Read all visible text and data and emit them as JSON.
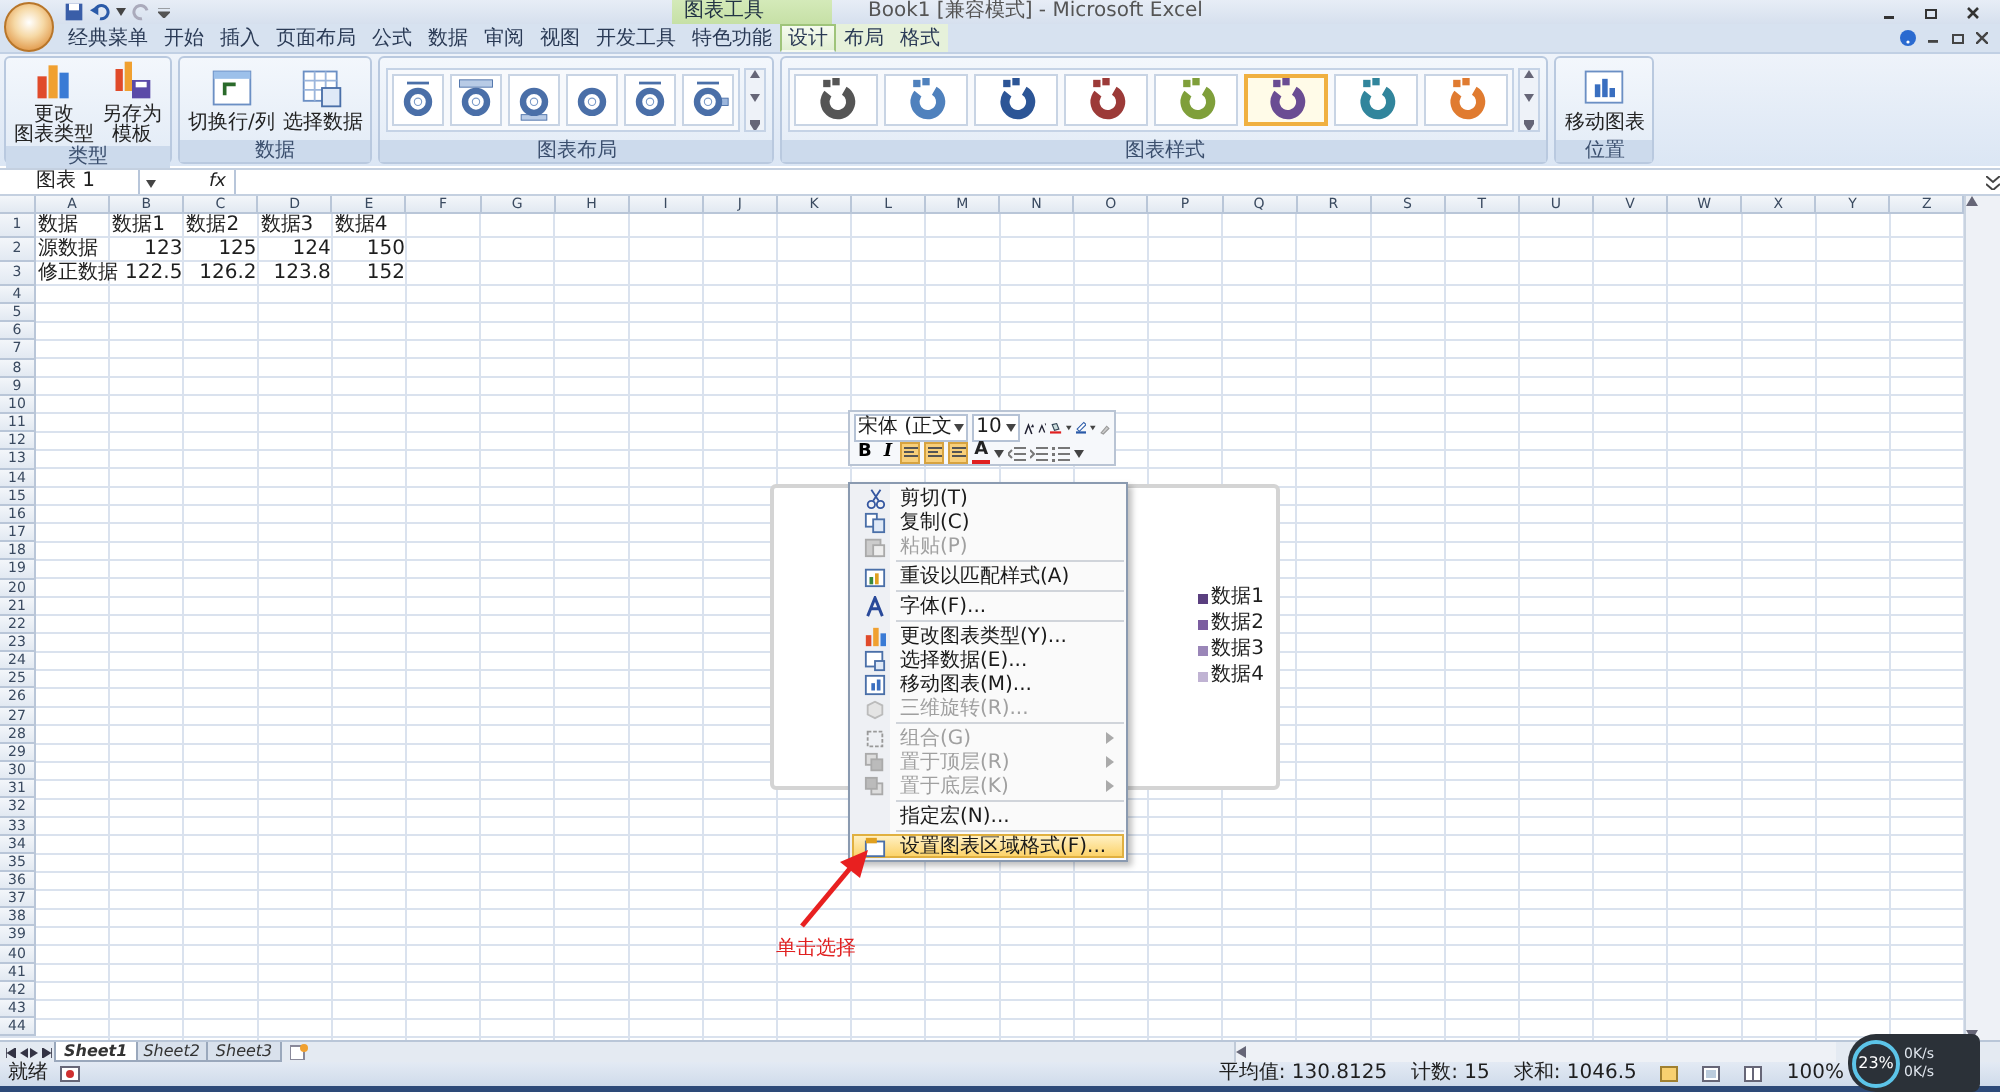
{
  "title_bar": {
    "context_tab": "图表工具",
    "title": "Book1 [兼容模式] - Microsoft Excel"
  },
  "tabs": [
    {
      "label": "经典菜单",
      "selected": false
    },
    {
      "label": "开始",
      "selected": false
    },
    {
      "label": "插入",
      "selected": false
    },
    {
      "label": "页面布局",
      "selected": false
    },
    {
      "label": "公式",
      "selected": false
    },
    {
      "label": "数据",
      "selected": false
    },
    {
      "label": "审阅",
      "selected": false
    },
    {
      "label": "视图",
      "selected": false
    },
    {
      "label": "开发工具",
      "selected": false
    },
    {
      "label": "特色功能",
      "selected": false
    },
    {
      "label": "设计",
      "selected": true,
      "contextual": true
    },
    {
      "label": "布局",
      "selected": false,
      "contextual": true
    },
    {
      "label": "格式",
      "selected": false,
      "contextual": true
    }
  ],
  "ribbon": {
    "groups": [
      {
        "kind": "buttons",
        "label": "类型",
        "buttons": [
          {
            "lines": [
              "更改",
              "图表类型"
            ]
          },
          {
            "lines": [
              "另存为",
              "模板"
            ]
          }
        ]
      },
      {
        "kind": "buttons",
        "label": "数据",
        "buttons": [
          {
            "lines": [
              "切换行/列"
            ]
          },
          {
            "lines": [
              "选择数据"
            ]
          }
        ]
      },
      {
        "kind": "layouts",
        "label": "图表布局",
        "items": [
          {
            "kind": "title"
          },
          {
            "kind": "banner"
          },
          {
            "kind": "bottom"
          },
          {
            "kind": "plain"
          },
          {
            "kind": "title"
          },
          {
            "kind": "legend"
          }
        ]
      },
      {
        "kind": "styles",
        "label": "图表样式",
        "items": [
          {
            "color": "#555555",
            "selected": false
          },
          {
            "color": "#4f81bd",
            "selected": false
          },
          {
            "color": "#2c5596",
            "selected": false
          },
          {
            "color": "#9c3a38",
            "selected": false
          },
          {
            "color": "#7f9f3a",
            "selected": false
          },
          {
            "color": "#6a4c93",
            "selected": true
          },
          {
            "color": "#31859c",
            "selected": false
          },
          {
            "color": "#e07b30",
            "selected": false
          }
        ]
      },
      {
        "kind": "buttons",
        "label": "位置",
        "buttons": [
          {
            "lines": [
              "移动图表"
            ]
          }
        ]
      }
    ]
  },
  "formula_bar": {
    "name_box": "图表 1",
    "fx": "fx"
  },
  "sheet": {
    "columns": [
      "A",
      "B",
      "C",
      "D",
      "E",
      "F",
      "G",
      "H",
      "I",
      "J",
      "K",
      "L",
      "M",
      "N",
      "O",
      "P",
      "Q",
      "R",
      "S",
      "T",
      "U",
      "V",
      "W",
      "X",
      "Y",
      "Z"
    ],
    "rows": [
      {
        "number": "1",
        "cells": [
          {
            "text": "数据",
            "kind": "text"
          },
          {
            "text": "数据1",
            "kind": "text"
          },
          {
            "text": "数据2",
            "kind": "text"
          },
          {
            "text": "数据3",
            "kind": "text"
          },
          {
            "text": "数据4",
            "kind": "text"
          }
        ]
      },
      {
        "number": "2",
        "cells": [
          {
            "text": "源数据",
            "kind": "text"
          },
          {
            "text": "123",
            "kind": "number"
          },
          {
            "text": "125",
            "kind": "number"
          },
          {
            "text": "124",
            "kind": "number"
          },
          {
            "text": "150",
            "kind": "number"
          }
        ]
      },
      {
        "number": "3",
        "cells": [
          {
            "text": "修正数据",
            "kind": "text"
          },
          {
            "text": "122.5",
            "kind": "number"
          },
          {
            "text": "126.2",
            "kind": "number"
          },
          {
            "text": "123.8",
            "kind": "number"
          },
          {
            "text": "152",
            "kind": "number"
          }
        ]
      },
      {
        "number": "4"
      },
      {
        "number": "5"
      },
      {
        "number": "6"
      },
      {
        "number": "7"
      },
      {
        "number": "8"
      },
      {
        "number": "9"
      },
      {
        "number": "10"
      },
      {
        "number": "11"
      },
      {
        "number": "12"
      },
      {
        "number": "13"
      },
      {
        "number": "14"
      },
      {
        "number": "15"
      },
      {
        "number": "16"
      },
      {
        "number": "17"
      },
      {
        "number": "18"
      },
      {
        "number": "19"
      },
      {
        "number": "20"
      },
      {
        "number": "21"
      },
      {
        "number": "22"
      },
      {
        "number": "23"
      },
      {
        "number": "24"
      },
      {
        "number": "25"
      },
      {
        "number": "26"
      },
      {
        "number": "27"
      },
      {
        "number": "28"
      },
      {
        "number": "29"
      },
      {
        "number": "30"
      },
      {
        "number": "31"
      },
      {
        "number": "32"
      },
      {
        "number": "33"
      },
      {
        "number": "34"
      },
      {
        "number": "35"
      },
      {
        "number": "36"
      },
      {
        "number": "37"
      },
      {
        "number": "38"
      },
      {
        "number": "39"
      },
      {
        "number": "40"
      },
      {
        "number": "41"
      },
      {
        "number": "42"
      },
      {
        "number": "43"
      },
      {
        "number": "44"
      }
    ]
  },
  "chart": {
    "legend": [
      {
        "label": "数据1",
        "color": "#5a3f7f"
      },
      {
        "label": "数据2",
        "color": "#7b5da0"
      },
      {
        "label": "数据3",
        "color": "#9a86b8"
      },
      {
        "label": "数据4",
        "color": "#c0b3d3"
      }
    ]
  },
  "mini_toolbar": {
    "font": "宋体 (正文",
    "size": "10",
    "bold": "B",
    "italic": "I",
    "font_color": "A",
    "align_buttons": [
      {
        "selected": true
      },
      {
        "selected": true
      },
      {
        "selected": true
      }
    ]
  },
  "context_menu": [
    {
      "label": "剪切(T)",
      "disabled": false,
      "selected": false
    },
    {
      "label": "复制(C)",
      "disabled": false,
      "selected": false
    },
    {
      "label": "粘贴(P)",
      "disabled": true,
      "selected": false
    },
    {
      "label": "重设以匹配样式(A)",
      "disabled": false,
      "selected": false,
      "separator_before": true
    },
    {
      "label": "字体(F)...",
      "disabled": false,
      "selected": false,
      "separator_before": true
    },
    {
      "label": "更改图表类型(Y)...",
      "disabled": false,
      "selected": false,
      "separator_before": true
    },
    {
      "label": "选择数据(E)...",
      "disabled": false,
      "selected": false
    },
    {
      "label": "移动图表(M)...",
      "disabled": false,
      "selected": false
    },
    {
      "label": "三维旋转(R)...",
      "disabled": true,
      "selected": false
    },
    {
      "label": "组合(G)",
      "disabled": true,
      "selected": false,
      "submenu": true,
      "separator_before": true
    },
    {
      "label": "置于顶层(R)",
      "disabled": true,
      "selected": false,
      "submenu": true
    },
    {
      "label": "置于底层(K)",
      "disabled": true,
      "selected": false,
      "submenu": true
    },
    {
      "label": "指定宏(N)...",
      "disabled": false,
      "selected": false,
      "separator_before": true
    },
    {
      "label": "设置图表区域格式(F)...",
      "disabled": false,
      "selected": true,
      "separator_before": true
    }
  ],
  "annotation": "单击选择",
  "sheet_tabs": [
    {
      "label": "Sheet1",
      "selected": true
    },
    {
      "label": "Sheet2",
      "selected": false
    },
    {
      "label": "Sheet3",
      "selected": false
    }
  ],
  "status_bar": {
    "ready": "就绪",
    "stats": [
      "平均值: 130.8125",
      "计数: 15",
      "求和: 1046.5"
    ],
    "zoom": "100%"
  },
  "monitor": {
    "percent": "23%",
    "rates": [
      "0K/s",
      "0K/s"
    ]
  }
}
